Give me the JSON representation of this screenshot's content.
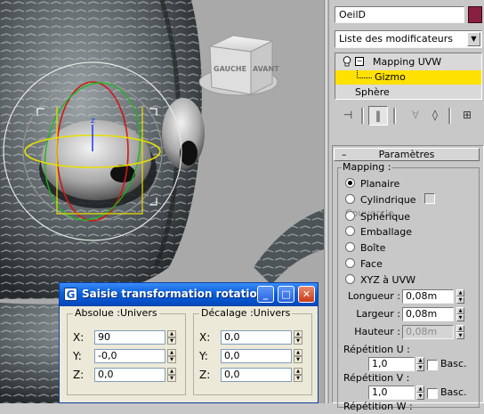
{
  "viewport": {
    "viewcube": {
      "face_left": "GAUCHE",
      "face_front": "AVANT"
    },
    "gizmo_axis_label": "z"
  },
  "panel": {
    "object_name": "OeilD",
    "object_color": "#8a1f3f",
    "modifier_list": "Liste des modificateurs",
    "stack": {
      "modifier": "Mapping UVW",
      "sub_object": "Gizmo",
      "base_object": "Sphère"
    },
    "rollout_title": "Paramètres",
    "mapping": {
      "legend": "Mapping :",
      "options": [
        "Planaire",
        "Cylindrique",
        "Sphérique",
        "Emballage",
        "Boîte",
        "Face",
        "XYZ à UVW"
      ],
      "selected": "Planaire",
      "couvercle_label": "Couvercle"
    },
    "params": {
      "longueur_label": "Longueur :",
      "longueur_value": "0,08m",
      "largeur_label": "Largeur :",
      "largeur_value": "0,08m",
      "hauteur_label": "Hauteur :",
      "hauteur_value": "0,08m",
      "rep_u_label": "Répétition U :",
      "rep_u_value": "1,0",
      "rep_v_label": "Répétition V :",
      "rep_v_value": "1,0",
      "rep_w_label": "Répétition W :",
      "basc_label": "Basc."
    }
  },
  "dialog": {
    "title": "Saisie transformation rotation",
    "absolute": {
      "legend": "Absolue :Univers",
      "x_label": "X:",
      "x_value": "90",
      "y_label": "Y:",
      "y_value": "-0,0",
      "z_label": "Z:",
      "z_value": "0,0"
    },
    "offset": {
      "legend": "Décalage :Univers",
      "x_label": "X:",
      "x_value": "0,0",
      "y_label": "Y:",
      "y_value": "0,0",
      "z_label": "Z:",
      "z_value": "0,0"
    }
  }
}
